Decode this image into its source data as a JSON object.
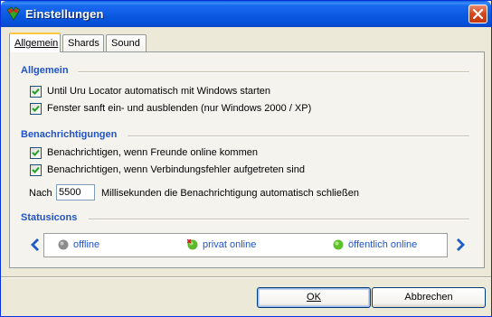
{
  "window": {
    "title": "Einstellungen"
  },
  "tabs": [
    {
      "label": "Allgemein",
      "active": true
    },
    {
      "label": "Shards",
      "active": false
    },
    {
      "label": "Sound",
      "active": false
    }
  ],
  "general": {
    "heading": "Allgemein",
    "options": [
      {
        "label": "Until Uru Locator automatisch mit Windows starten",
        "checked": true
      },
      {
        "label": "Fenster sanft ein- und ausblenden (nur Windows 2000 / XP)",
        "checked": true
      }
    ]
  },
  "notifications": {
    "heading": "Benachrichtigungen",
    "options": [
      {
        "label": "Benachrichtigen, wenn Freunde online kommen",
        "checked": true
      },
      {
        "label": "Benachrichtigen, wenn Verbindungsfehler aufgetreten sind",
        "checked": true
      }
    ],
    "prefix": "Nach",
    "value": "5500",
    "suffix": "Millisekunden die Benachrichtigung automatisch schließen"
  },
  "statusicons": {
    "heading": "Statusicons",
    "items": [
      {
        "label": "offline",
        "icon": "gray-status-icon",
        "color": "#8c8c8c"
      },
      {
        "label": "privat online",
        "icon": "green-private-status-icon",
        "color": "#5cb82c"
      },
      {
        "label": "öffentlich online",
        "icon": "green-status-icon",
        "color": "#5cc12c"
      }
    ]
  },
  "buttons": {
    "ok": "OK",
    "cancel": "Abbrechen"
  },
  "colors": {
    "heading": "#2153c6",
    "titlebar": "#0a58e0",
    "face": "#ece9d8"
  }
}
